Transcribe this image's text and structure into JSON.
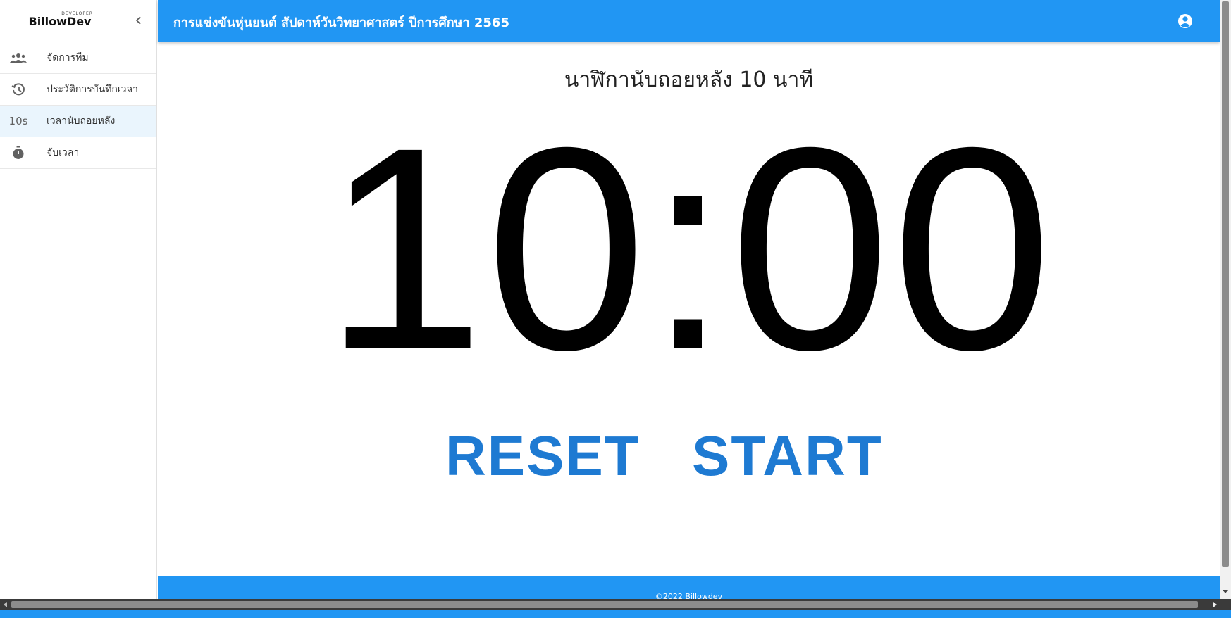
{
  "app": {
    "logo_text": "BillowDev",
    "logo_tagline": "DEVELOPER",
    "title": "การแข่งขันหุ่นยนต์ สัปดาห์วันวิทยาศาสตร์ ปีการศึกษา 2565"
  },
  "sidebar": {
    "items": [
      {
        "label": "จัดการทีม",
        "icon": "team-icon",
        "active": false
      },
      {
        "label": "ประวัติการบันทึกเวลา",
        "icon": "history-icon",
        "active": false
      },
      {
        "label": "เวลานับถอยหลัง",
        "icon": "countdown-10s-icon",
        "icon_text": "10s",
        "active": true
      },
      {
        "label": "จับเวลา",
        "icon": "stopwatch-icon",
        "active": false
      }
    ]
  },
  "timer": {
    "subtitle": "นาฬิกานับถอยหลัง 10 นาที",
    "display": "10:00",
    "reset_label": "RESET",
    "start_label": "START"
  },
  "footer": {
    "text": "©2022 Billowdev"
  },
  "colors": {
    "primary": "#2196f3",
    "button_text": "#1e7ad2",
    "active_nav_bg": "#eaf5fd"
  }
}
